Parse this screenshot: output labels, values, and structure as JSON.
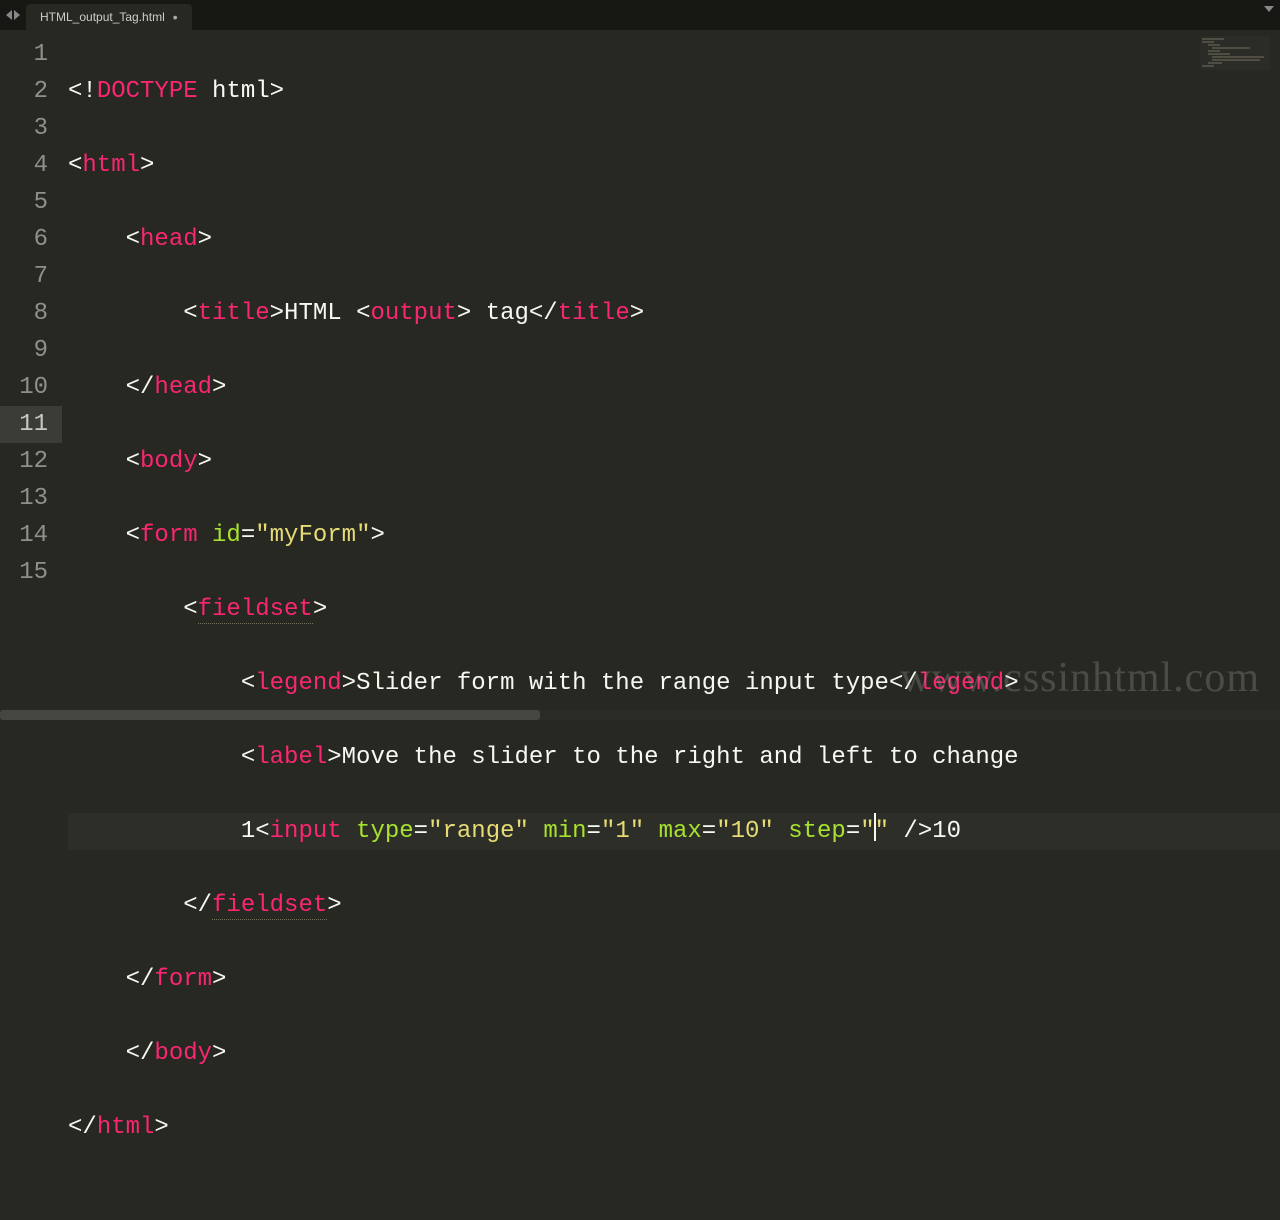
{
  "tab": {
    "title": "HTML_output_Tag.html",
    "dirty_marker": "•"
  },
  "code": {
    "lines": {
      "l1": {
        "doctype_kw": "DOCTYPE",
        "doctype_rest": " html"
      },
      "l2": {
        "tag": "html"
      },
      "l3": {
        "tag": "head"
      },
      "l4": {
        "title_open": "title",
        "txt1": "HTML ",
        "out_tag": "output",
        "txt2": " tag",
        "title_close": "title"
      },
      "l5": {
        "tag": "head"
      },
      "l6": {
        "tag": "body"
      },
      "l7": {
        "tag": "form",
        "attr": "id",
        "val": "\"myForm\""
      },
      "l8": {
        "tag": "fieldset"
      },
      "l9": {
        "tag": "legend",
        "txt": "Slider form with the range input type"
      },
      "l10": {
        "tag": "label",
        "txt": "Move the slider to the right and left to change "
      },
      "l11": {
        "pre": "1",
        "tag": "input",
        "a1": "type",
        "v1": "\"range\"",
        "a2": "min",
        "v2": "\"1\"",
        "a3": "max",
        "v3": "\"10\"",
        "a4": "step",
        "v4": "\"\"",
        "post": "10"
      },
      "l12": {
        "tag": "fieldset"
      },
      "l13": {
        "tag": "form"
      },
      "l14": {
        "tag": "body"
      },
      "l15": {
        "tag": "html"
      }
    },
    "line_numbers": [
      "1",
      "2",
      "3",
      "4",
      "5",
      "6",
      "7",
      "8",
      "9",
      "10",
      "11",
      "12",
      "13",
      "14",
      "15"
    ],
    "active_line": 11
  },
  "watermark": "www.cssinhtml.com"
}
